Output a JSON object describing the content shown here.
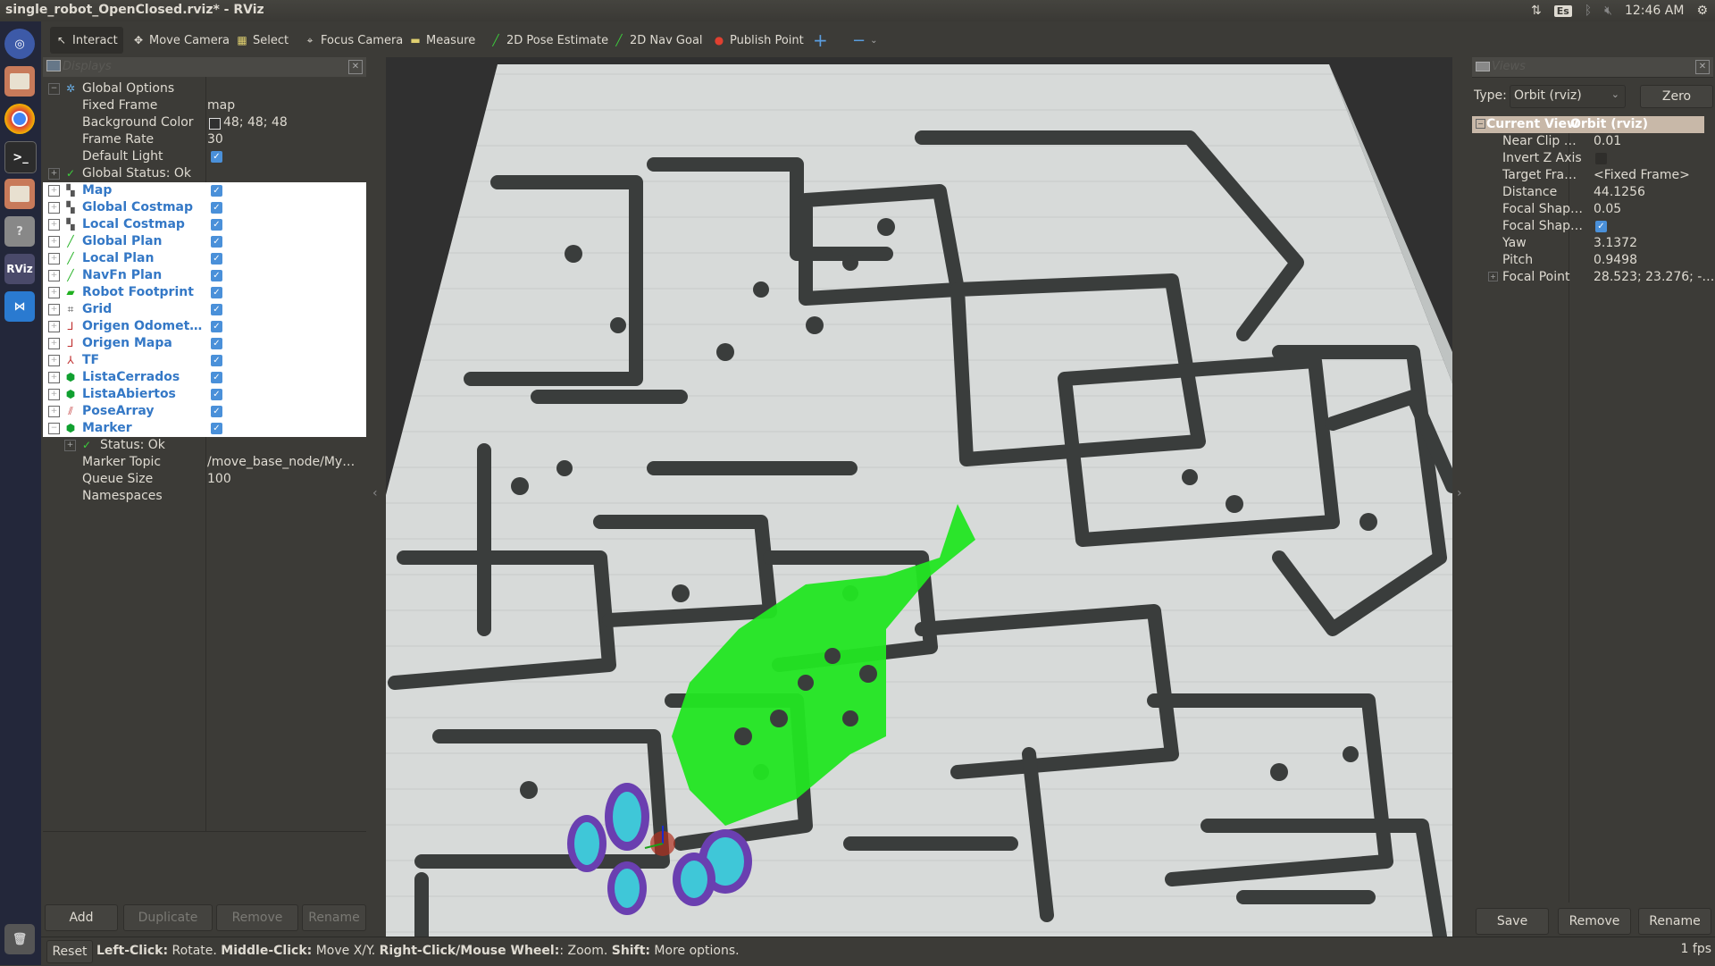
{
  "window": {
    "title": "single_robot_OpenClosed.rviz* - RViz"
  },
  "tray": {
    "lang": "Es",
    "time": "12:46 AM"
  },
  "launcher": {
    "items": [
      "ubuntu-dash-icon",
      "files-icon",
      "chrome-icon",
      "terminal-icon",
      "files-icon",
      "help-icon",
      "rviz-icon",
      "vscode-icon",
      "trash-icon"
    ],
    "rviz_label": "RViz"
  },
  "toolbar": {
    "tools": [
      {
        "label": "Interact",
        "icon": "cursor-icon"
      },
      {
        "label": "Move Camera",
        "icon": "move-icon"
      },
      {
        "label": "Select",
        "icon": "select-icon"
      },
      {
        "label": "Focus Camera",
        "icon": "focus-icon"
      },
      {
        "label": "Measure",
        "icon": "ruler-icon"
      },
      {
        "label": "2D Pose Estimate",
        "icon": "green-arrow-icon"
      },
      {
        "label": "2D Nav Goal",
        "icon": "green-arrow-icon"
      },
      {
        "label": "Publish Point",
        "icon": "pin-icon"
      }
    ]
  },
  "displays": {
    "title": "Displays",
    "global_options": "Global Options",
    "fixed_frame": {
      "label": "Fixed Frame",
      "value": "map"
    },
    "background_color": {
      "label": "Background Color",
      "value": "48; 48; 48"
    },
    "frame_rate": {
      "label": "Frame Rate",
      "value": "30"
    },
    "default_light": {
      "label": "Default Light"
    },
    "global_status": "Global Status: Ok",
    "items": [
      {
        "label": "Map",
        "icon": "map-icon"
      },
      {
        "label": "Global Costmap",
        "icon": "map-icon"
      },
      {
        "label": "Local Costmap",
        "icon": "map-icon"
      },
      {
        "label": "Global Plan",
        "icon": "path-icon"
      },
      {
        "label": "Local Plan",
        "icon": "path-icon"
      },
      {
        "label": "NavFn Plan",
        "icon": "path-icon"
      },
      {
        "label": "Robot Footprint",
        "icon": "polygon-icon"
      },
      {
        "label": "Grid",
        "icon": "grid-icon"
      },
      {
        "label": "Origen Odomet…",
        "icon": "axes-icon"
      },
      {
        "label": "Origen Mapa",
        "icon": "axes-icon"
      },
      {
        "label": "TF",
        "icon": "tf-icon"
      },
      {
        "label": "ListaCerrados",
        "icon": "marker-icon"
      },
      {
        "label": "ListaAbiertos",
        "icon": "marker-icon"
      },
      {
        "label": "PoseArray",
        "icon": "posearray-icon"
      },
      {
        "label": "Marker",
        "icon": "marker-icon"
      }
    ],
    "marker_status": "Status: Ok",
    "marker_topic": {
      "label": "Marker Topic",
      "value": "/move_base_node/My…"
    },
    "queue_size": {
      "label": "Queue Size",
      "value": "100"
    },
    "namespaces": {
      "label": "Namespaces"
    },
    "buttons": {
      "add": "Add",
      "duplicate": "Duplicate",
      "remove": "Remove",
      "rename": "Rename"
    }
  },
  "views": {
    "title": "Views",
    "type_label": "Type:",
    "type_value": "Orbit (rviz)",
    "zero": "Zero",
    "current_view": {
      "label": "Current View",
      "value": "Orbit (rviz)"
    },
    "props": [
      {
        "k": "Near Clip …",
        "v": "0.01"
      },
      {
        "k": "Invert Z Axis",
        "v": ""
      },
      {
        "k": "Target Fra…",
        "v": "<Fixed Frame>"
      },
      {
        "k": "Distance",
        "v": "44.1256"
      },
      {
        "k": "Focal Shap…",
        "v": "0.05"
      },
      {
        "k": "Focal Shap…",
        "v": ""
      },
      {
        "k": "Yaw",
        "v": "3.1372"
      },
      {
        "k": "Pitch",
        "v": "0.9498"
      },
      {
        "k": "Focal Point",
        "v": "28.523; 23.276; -…"
      }
    ],
    "buttons": {
      "save": "Save",
      "remove": "Remove",
      "rename": "Rename"
    }
  },
  "status": {
    "reset": "Reset",
    "left_click": "Left-Click:",
    "left_desc": " Rotate. ",
    "middle_click": "Middle-Click:",
    "middle_desc": " Move X/Y. ",
    "right_click": "Right-Click/Mouse Wheel:",
    "right_desc": ": Zoom. ",
    "shift": "Shift:",
    "shift_desc": " More options.",
    "fps": "1 fps"
  }
}
